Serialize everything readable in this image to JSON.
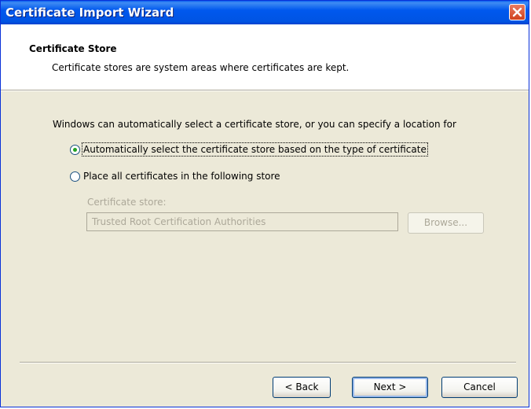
{
  "window": {
    "title": "Certificate Import Wizard"
  },
  "header": {
    "title": "Certificate Store",
    "subtitle": "Certificate stores are system areas where certificates are kept."
  },
  "body": {
    "intro": "Windows can automatically select a certificate store, or you can specify a location for",
    "option_auto": {
      "label": "Automatically select the certificate store based on the type of certificate",
      "checked": true
    },
    "option_manual": {
      "label": "Place all certificates in the following store",
      "checked": false
    },
    "store_label": "Certificate store:",
    "store_value": "Trusted Root Certification Authorities",
    "browse_label": "Browse..."
  },
  "footer": {
    "back_label": "< Back",
    "next_label": "Next >",
    "cancel_label": "Cancel"
  },
  "colors": {
    "titlebar": "#0054e3",
    "dialog_bg": "#ece9d8",
    "disabled_text": "#aca899",
    "radio_dot": "#21a121"
  }
}
